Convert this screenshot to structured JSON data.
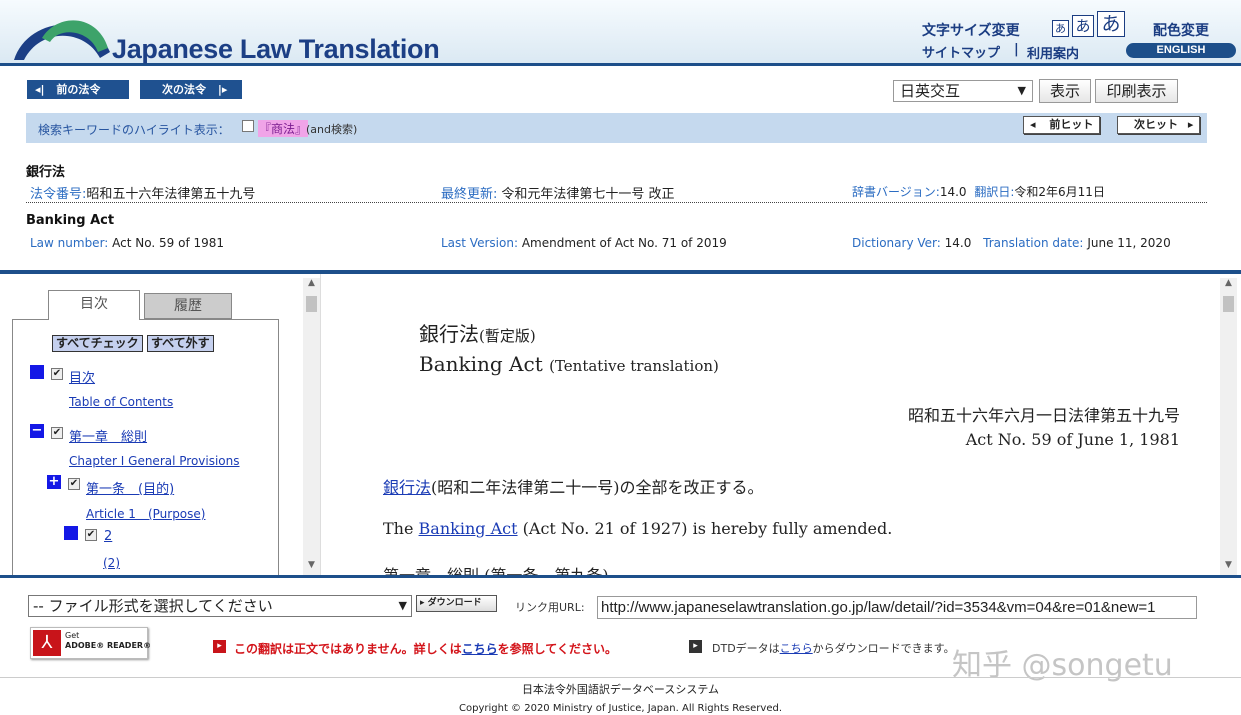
{
  "header": {
    "logo_text": "Japanese Law Translation",
    "font_size_label": "文字サイズ変更",
    "font_sizes": [
      "あ",
      "あ",
      "あ"
    ],
    "color_change": "配色変更",
    "sitemap": "サイトマップ",
    "separator": "|",
    "guide": "利用案内",
    "english": "ENGLISH"
  },
  "nav": {
    "prev_law": "前の法令",
    "next_law": "次の法令",
    "display_mode": "日英交互",
    "show": "表示",
    "print_view": "印刷表示"
  },
  "highlight": {
    "label": "検索キーワードのハイライト表示：",
    "keyword": "『商法』",
    "and_search": "(and検索)",
    "prev_hit": "前ヒット",
    "next_hit": "次ヒット"
  },
  "law_info": {
    "ja_title": "銀行法",
    "ja_number_label": "法令番号:",
    "ja_number": "昭和五十六年法律第五十九号",
    "ja_updated_label": "最終更新:",
    "ja_updated": "令和元年法律第七十一号 改正",
    "ja_dict_label": "辞書バージョン:",
    "ja_dict": "14.0",
    "ja_trans_label": "翻訳日:",
    "ja_trans": "令和2年6月11日",
    "en_title": "Banking Act",
    "en_number_label": "Law number:",
    "en_number": "Act No. 59 of 1981",
    "en_version_label": "Last Version:",
    "en_version": "Amendment of Act No. 71 of 2019",
    "en_dict_label": "Dictionary Ver:",
    "en_dict": "14.0",
    "en_trans_label": "Translation date:",
    "en_trans": "June 11, 2020"
  },
  "toc": {
    "tab_toc": "目次",
    "tab_history": "履歴",
    "check_all": "すべてチェック",
    "uncheck_all": "すべて外す",
    "items": [
      {
        "ja": "目次",
        "en": "Table of Contents"
      },
      {
        "ja": "第一章　総則",
        "en": "Chapter I General Provisions"
      },
      {
        "ja": "第一条　(目的)",
        "en": "Article 1　(Purpose)"
      },
      {
        "ja": "2",
        "en": "(2)"
      }
    ]
  },
  "content": {
    "title_ja": "銀行法",
    "title_ja_sub": "(暫定版)",
    "title_en": "Banking Act",
    "title_en_sub": "(Tentative translation)",
    "act_ja": "昭和五十六年六月一日法律第五十九号",
    "act_en": "Act No. 59 of June 1, 1981",
    "amend_ja_link": "銀行法",
    "amend_ja_rest": "(昭和二年法律第二十一号)の全部を改正する。",
    "amend_en_pre": "The",
    "amend_en_link": "Banking Act",
    "amend_en_rest": "(Act No. 21 of 1927) is hereby fully amended.",
    "chapter_peek": "第一章　総則 (第一条—第九条)"
  },
  "bottom": {
    "file_select": "-- ファイル形式を選択してください",
    "download": "ダウンロード",
    "link_url_label": "リンク用URL:",
    "link_url": "http://www.japaneselawtranslation.go.jp/law/detail/?id=3534&vm=04&re=01&new=1",
    "adobe_get": "Get",
    "adobe_reader": "ADOBE® READER®",
    "notice_pre": "この翻訳は正文ではありません。詳しくは",
    "notice_link": "こちら",
    "notice_post": "を参照してください。",
    "dtd_pre": "DTDデータは",
    "dtd_link": "こちら",
    "dtd_post": "からダウンロードできます。",
    "watermark": "知乎 @songetu",
    "system_name": "日本法令外国語訳データベースシステム",
    "copyright": "Copyright © 2020 Ministry of Justice, Japan. All Rights Reserved."
  },
  "colors": {
    "brand_blue": "#1d4f8a",
    "link_blue": "#1a3bb5",
    "notice_red": "#d3141a",
    "highlight_pink": "#f0a4e8"
  }
}
